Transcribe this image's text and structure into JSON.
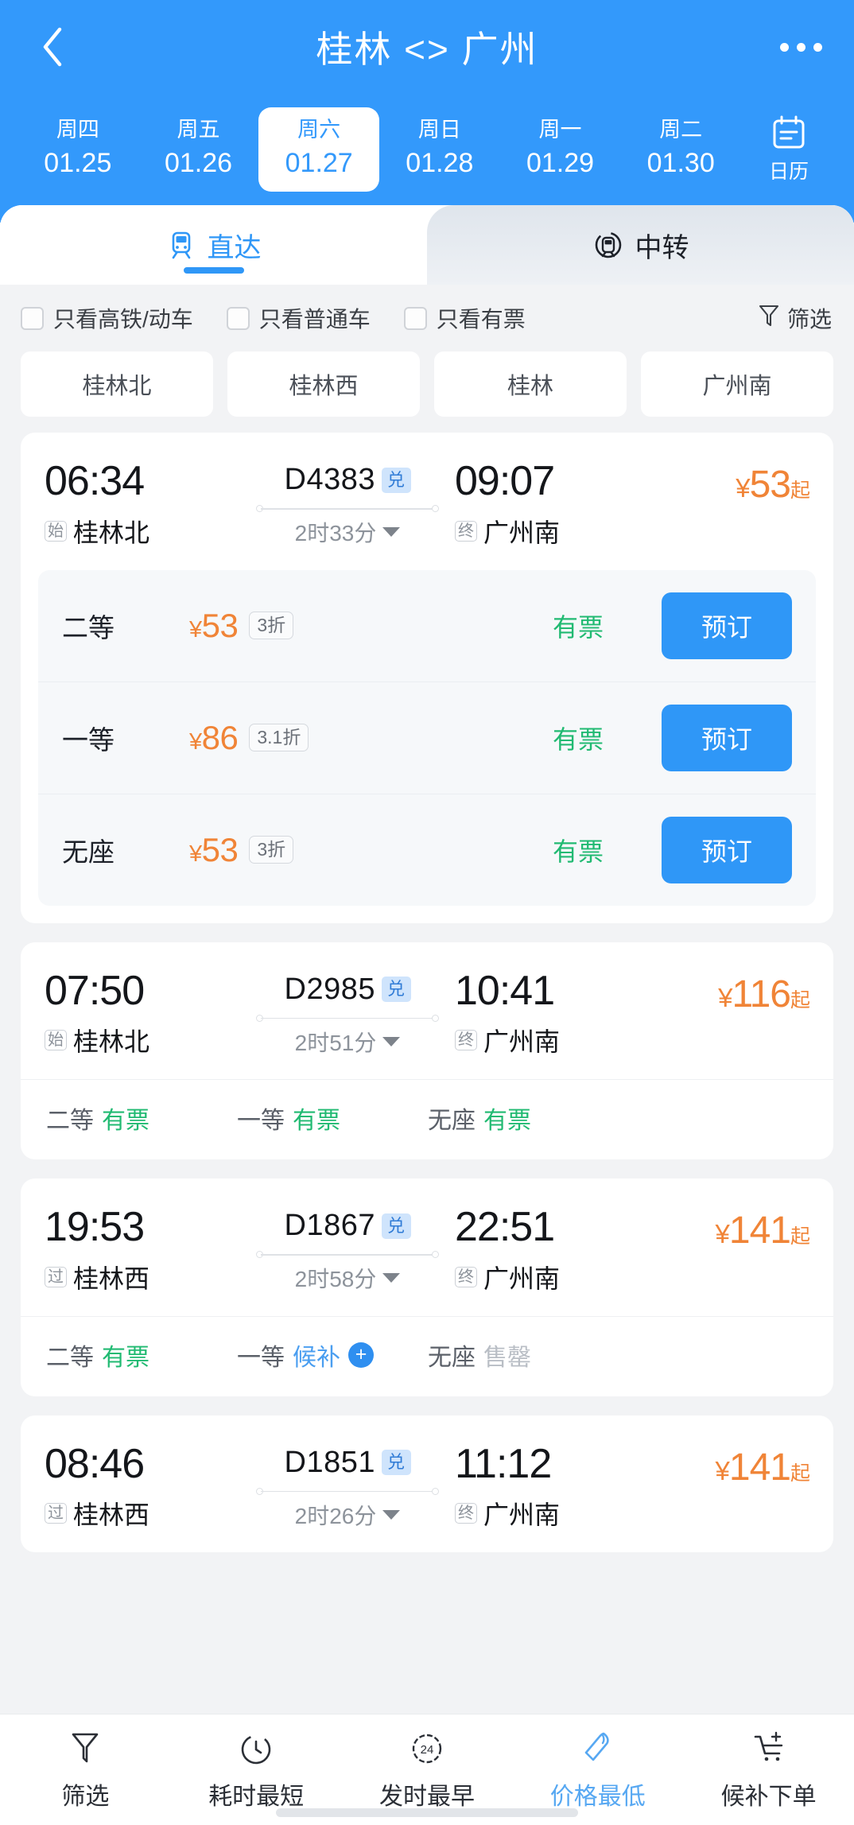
{
  "header": {
    "title": "桂林 <> 广州",
    "back_icon": "chevron-left-icon",
    "more_icon": "more-options-icon",
    "dates": [
      {
        "dow": "周四",
        "date": "01.25",
        "active": false
      },
      {
        "dow": "周五",
        "date": "01.26",
        "active": false
      },
      {
        "dow": "周六",
        "date": "01.27",
        "active": true
      },
      {
        "dow": "周日",
        "date": "01.28",
        "active": false
      },
      {
        "dow": "周一",
        "date": "01.29",
        "active": false
      },
      {
        "dow": "周二",
        "date": "01.30",
        "active": false
      }
    ],
    "calendar": {
      "label": "日历",
      "icon": "calendar-icon"
    },
    "bg_color": "#3399fb"
  },
  "tabs": [
    {
      "label": "直达",
      "icon": "train-icon",
      "active": true
    },
    {
      "label": "中转",
      "icon": "transfer-train-icon",
      "active": false
    }
  ],
  "filters": {
    "checkboxes": [
      {
        "label": "只看高铁/动车",
        "checked": false
      },
      {
        "label": "只看普通车",
        "checked": false
      },
      {
        "label": "只看有票",
        "checked": false
      }
    ],
    "filter_button": {
      "label": "筛选",
      "icon": "funnel-icon"
    }
  },
  "station_chips": [
    {
      "label": "桂林北"
    },
    {
      "label": "桂林西"
    },
    {
      "label": "桂林"
    },
    {
      "label": "广州南"
    }
  ],
  "trains": [
    {
      "depart_time": "06:34",
      "arrive_time": "09:07",
      "train_no": "D4383",
      "exchange_badge": "兑",
      "depart_tag": "始",
      "depart_station": "桂林北",
      "arrive_tag": "终",
      "arrive_station": "广州南",
      "duration": "2时33分",
      "price_prefix": "¥",
      "price": "53",
      "price_suffix": "起",
      "expanded": true,
      "seats": [
        {
          "name": "二等",
          "price_prefix": "¥",
          "price": "53",
          "discount": "3折",
          "status": "有票",
          "status_type": "avail",
          "button": "预订"
        },
        {
          "name": "一等",
          "price_prefix": "¥",
          "price": "86",
          "discount": "3.1折",
          "status": "有票",
          "status_type": "avail",
          "button": "预订"
        },
        {
          "name": "无座",
          "price_prefix": "¥",
          "price": "53",
          "discount": "3折",
          "status": "有票",
          "status_type": "avail",
          "button": "预订"
        }
      ]
    },
    {
      "depart_time": "07:50",
      "arrive_time": "10:41",
      "train_no": "D2985",
      "exchange_badge": "兑",
      "depart_tag": "始",
      "depart_station": "桂林北",
      "arrive_tag": "终",
      "arrive_station": "广州南",
      "duration": "2时51分",
      "price_prefix": "¥",
      "price": "116",
      "price_suffix": "起",
      "expanded": false,
      "summary": [
        {
          "name": "二等",
          "status": "有票",
          "status_type": "avail"
        },
        {
          "name": "一等",
          "status": "有票",
          "status_type": "avail"
        },
        {
          "name": "无座",
          "status": "有票",
          "status_type": "avail"
        }
      ]
    },
    {
      "depart_time": "19:53",
      "arrive_time": "22:51",
      "train_no": "D1867",
      "exchange_badge": "兑",
      "depart_tag": "过",
      "depart_station": "桂林西",
      "arrive_tag": "终",
      "arrive_station": "广州南",
      "duration": "2时58分",
      "price_prefix": "¥",
      "price": "141",
      "price_suffix": "起",
      "expanded": false,
      "summary": [
        {
          "name": "二等",
          "status": "有票",
          "status_type": "avail"
        },
        {
          "name": "一等",
          "status": "候补",
          "status_type": "wait"
        },
        {
          "name": "无座",
          "status": "售罄",
          "status_type": "sold"
        }
      ]
    },
    {
      "depart_time": "08:46",
      "arrive_time": "11:12",
      "train_no": "D1851",
      "exchange_badge": "兑",
      "depart_tag": "过",
      "depart_station": "桂林西",
      "arrive_tag": "终",
      "arrive_station": "广州南",
      "duration": "2时26分",
      "price_prefix": "¥",
      "price": "141",
      "price_suffix": "起",
      "expanded": false,
      "summary": []
    }
  ],
  "bottom_bar": [
    {
      "label": "筛选",
      "icon": "funnel-icon",
      "active": false
    },
    {
      "label": "耗时最短",
      "icon": "stopwatch-icon",
      "active": false
    },
    {
      "label": "发时最早",
      "icon": "clock-24-icon",
      "active": false
    },
    {
      "label": "价格最低",
      "icon": "price-tag-icon",
      "active": true
    },
    {
      "label": "候补下单",
      "icon": "cart-plus-icon",
      "active": false
    }
  ],
  "colors": {
    "brand_blue": "#3399fb",
    "accent_blue": "#2f97f7",
    "price_orange": "#f08437",
    "avail_green": "#21ba72",
    "sold_gray": "#b9bec5"
  }
}
